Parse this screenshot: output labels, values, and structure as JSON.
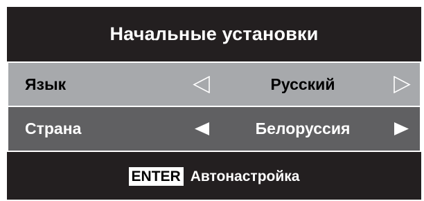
{
  "menu": {
    "title": "Начальные установки",
    "rows": [
      {
        "label": "Язык",
        "value": "Русский",
        "left_arrow_icon": "triangle-left-outline-icon",
        "right_arrow_icon": "triangle-right-outline-icon",
        "background": "#a7a9ac",
        "selected": false
      },
      {
        "label": "Страна",
        "value": "Белоруссия",
        "left_arrow_icon": "triangle-left-filled-icon",
        "right_arrow_icon": "triangle-right-filled-icon",
        "background": "#606062",
        "selected": true
      }
    ],
    "footer": {
      "key_label": "ENTER",
      "action_label": "Автонастройка"
    }
  },
  "colors": {
    "panel_background": "#231f20",
    "text_light": "#ffffff",
    "text_dark": "#000000"
  }
}
